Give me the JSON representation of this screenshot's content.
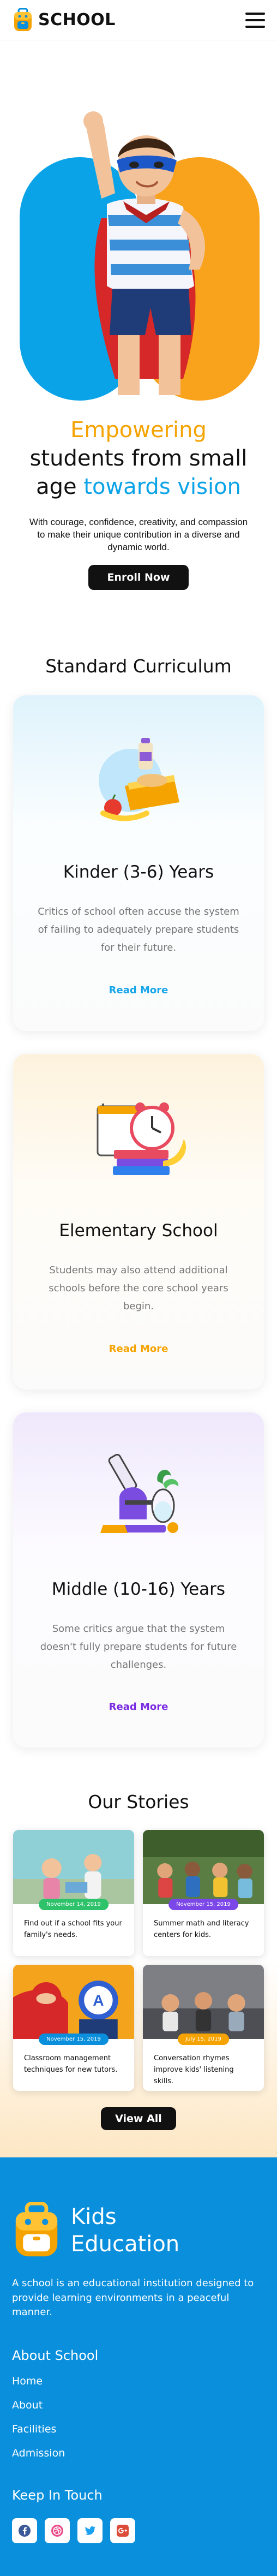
{
  "header": {
    "brand": "SCHOOL"
  },
  "hero": {
    "title_line1": "Empowering",
    "title_line2": "students from small",
    "title_line3a": "age",
    "title_line3b": "towards vision",
    "description": "With courage, confidence, creativity, and compassion to make their unique contribution in a diverse and dynamic world.",
    "cta": "Enroll Now"
  },
  "curriculum": {
    "title": "Standard Curriculum",
    "cards": [
      {
        "title": "Kinder (3-6) Years",
        "description": "Critics of school often accuse the system of failing to adequately prepare students for their future.",
        "link": "Read More",
        "link_color": "#16a6ea"
      },
      {
        "title": "Elementary School",
        "description": "Students may also attend additional schools before the core school years begin.",
        "link": "Read More",
        "link_color": "#f5a300"
      },
      {
        "title": "Middle (10-16) Years",
        "description": "Some critics argue that the system doesn't fully prepare students for future challenges.",
        "link": "Read More",
        "link_color": "#7a2be2"
      }
    ]
  },
  "stories": {
    "title": "Our Stories",
    "items": [
      {
        "date": "November 14, 2019",
        "date_color": "#2ec26a",
        "text": "Find out if a school fits your family's needs."
      },
      {
        "date": "November 15, 2019",
        "date_color": "#7c47e8",
        "text": "Summer math and literacy centers for kids."
      },
      {
        "date": "November 15, 2019",
        "date_color": "#0a8fdc",
        "text": "Classroom management techniques for new tutors."
      },
      {
        "date": "July 15, 2019",
        "date_color": "#f5a300",
        "text": "Conversation rhymes improve kids' listening skills."
      }
    ],
    "cta": "View All"
  },
  "footer": {
    "brand_line1": "Kids",
    "brand_line2": "Education",
    "description": "A school is an educational institution designed to provide learning environments in a peaceful manner.",
    "about_heading": "About School",
    "links": [
      "Home",
      "About",
      "Facilities",
      "Admission"
    ],
    "social_heading": "Keep In Touch",
    "social": [
      {
        "icon": "facebook-icon",
        "color": "#3b5998"
      },
      {
        "icon": "dribbble-icon",
        "color": "#ea4c89"
      },
      {
        "icon": "twitter-icon",
        "color": "#1da1f2"
      },
      {
        "icon": "google-plus-icon",
        "color": "#dd4b39"
      }
    ]
  },
  "colors": {
    "accent_orange": "#f5a300",
    "accent_blue": "#0aa3e8",
    "footer_blue": "#0a8fdc"
  }
}
